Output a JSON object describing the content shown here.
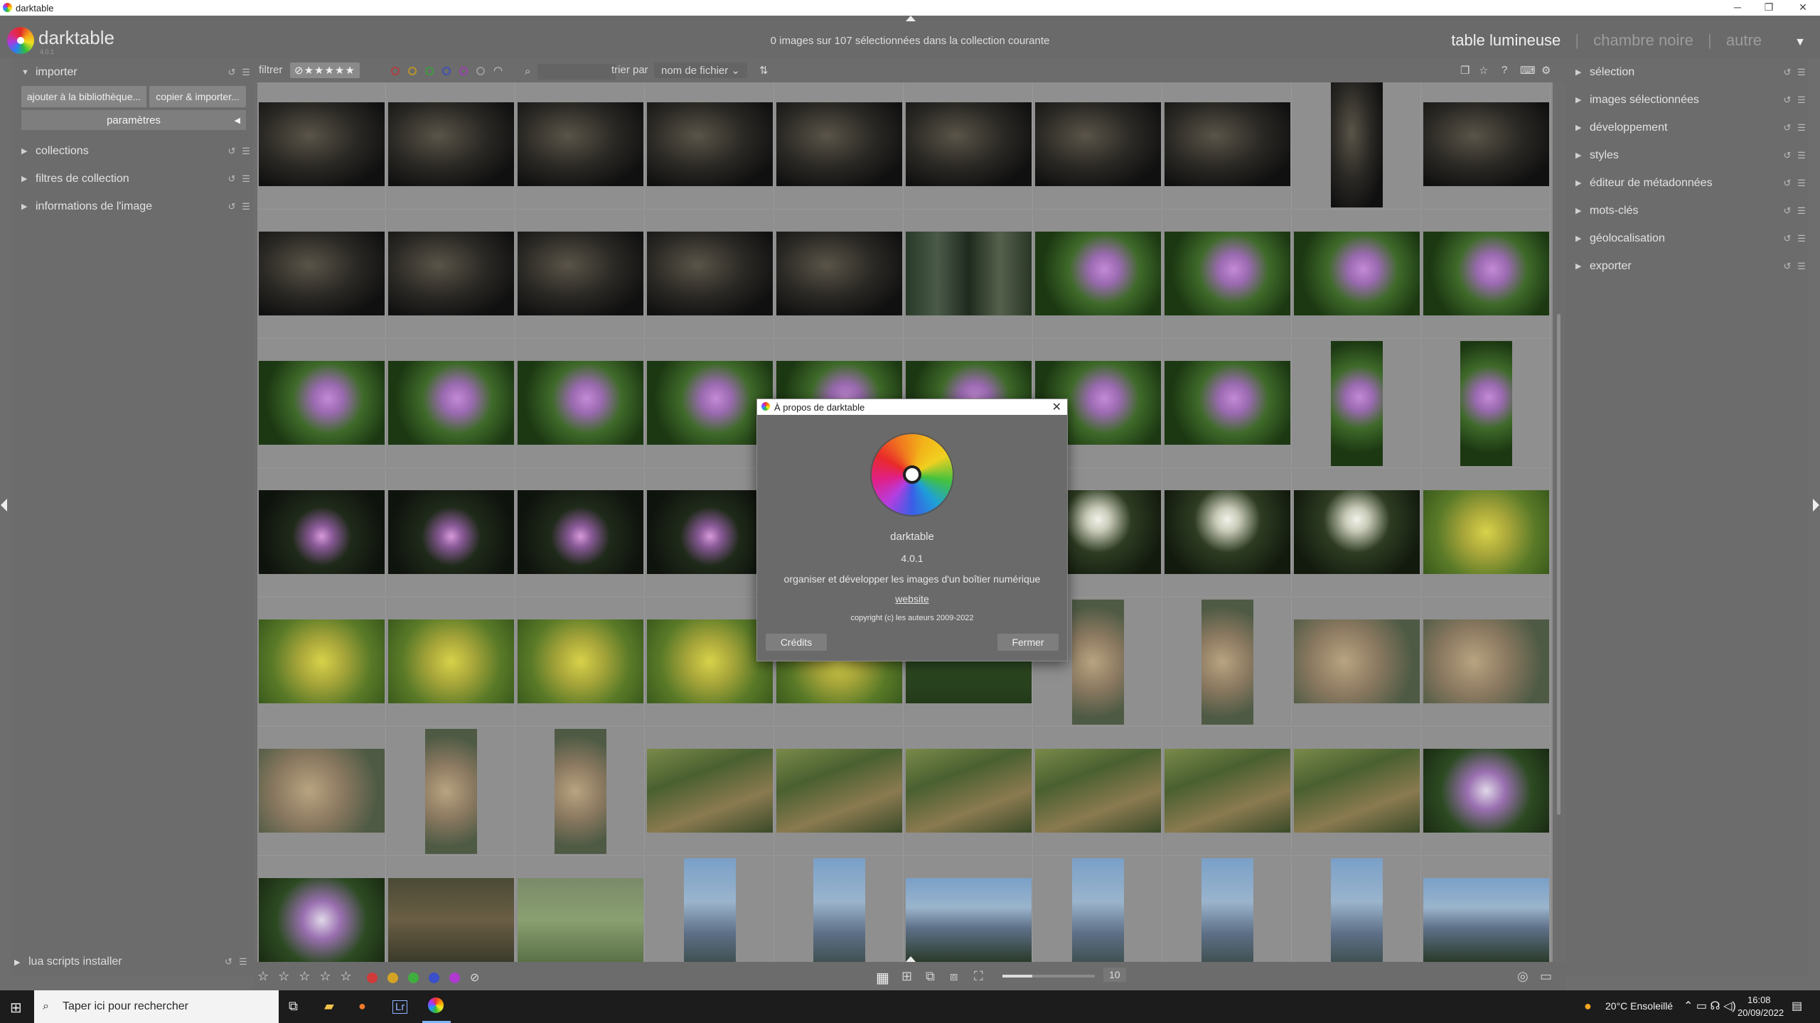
{
  "window": {
    "title": "darktable",
    "min": "─",
    "restore": "❐",
    "close": "✕"
  },
  "brand": {
    "name": "darktable",
    "version": "4.0.1"
  },
  "status": "0 images sur 107 sélectionnées dans la collection courante",
  "views": {
    "lighttable": "table lumineuse",
    "darkroom": "chambre noire",
    "other": "autre",
    "sep": "|"
  },
  "left": {
    "import": {
      "label": "importer",
      "add": "ajouter à la bibliothèque...",
      "copy": "copier & importer...",
      "params": "paramètres"
    },
    "modules": [
      "collections",
      "filtres de collection",
      "informations de l'image"
    ],
    "bottom": "lua scripts installer"
  },
  "right": {
    "modules": [
      "sélection",
      "images sélectionnées",
      "développement",
      "styles",
      "éditeur de métadonnées",
      "mots-clés",
      "géolocalisation",
      "exporter"
    ]
  },
  "filter": {
    "label": "filtrer",
    "stars": "⊘★★★★★",
    "sort_label": "trier par",
    "sort_value": "nom de fichier"
  },
  "colors": {
    "red": "#d03a3a",
    "yellow": "#d4a324",
    "green": "#3fae3f",
    "blue": "#3a4fc9",
    "purple": "#b03ad0"
  },
  "bottom": {
    "stars": "☆ ☆ ☆ ☆ ☆",
    "zoom": "10"
  },
  "thumbs": [
    "rock",
    "rock",
    "rock",
    "rock",
    "rock",
    "rock",
    "rock",
    "rock",
    "rockp",
    "rock",
    "rock",
    "rock",
    "rock",
    "rock",
    "rock",
    "forest",
    "flower",
    "flower",
    "flower",
    "flower",
    "flower",
    "flower",
    "flower",
    "flower",
    "flower",
    "flower",
    "flower",
    "flower",
    "flowerp",
    "flowerp",
    "pink",
    "pink",
    "pink",
    "pink",
    "pink",
    "pink",
    "white",
    "white",
    "white",
    "yellow",
    "yellow",
    "yellow",
    "yellow",
    "yellow",
    "yellow",
    "meadow",
    "stonep",
    "stonep",
    "stone",
    "stone",
    "stone",
    "stonep",
    "stonep",
    "grass",
    "grass",
    "grass",
    "grass",
    "grass",
    "grass",
    "mixed",
    "mixed",
    "ground",
    "wild",
    "mtnp",
    "mtnp",
    "mtn",
    "mtnp",
    "mtnp",
    "mtnp",
    "mtn"
  ],
  "dialog": {
    "title": "À propos de darktable",
    "name": "darktable",
    "version": "4.0.1",
    "description": "organiser et développer les images d'un boîtier numérique",
    "website": "website",
    "copyright": "copyright (c) les auteurs 2009-2022",
    "credits": "Crédits",
    "close": "Fermer"
  },
  "taskbar": {
    "search": "Taper ici pour rechercher",
    "weather": "20°C Ensoleillé",
    "time": "16:08",
    "date": "20/09/2022"
  }
}
